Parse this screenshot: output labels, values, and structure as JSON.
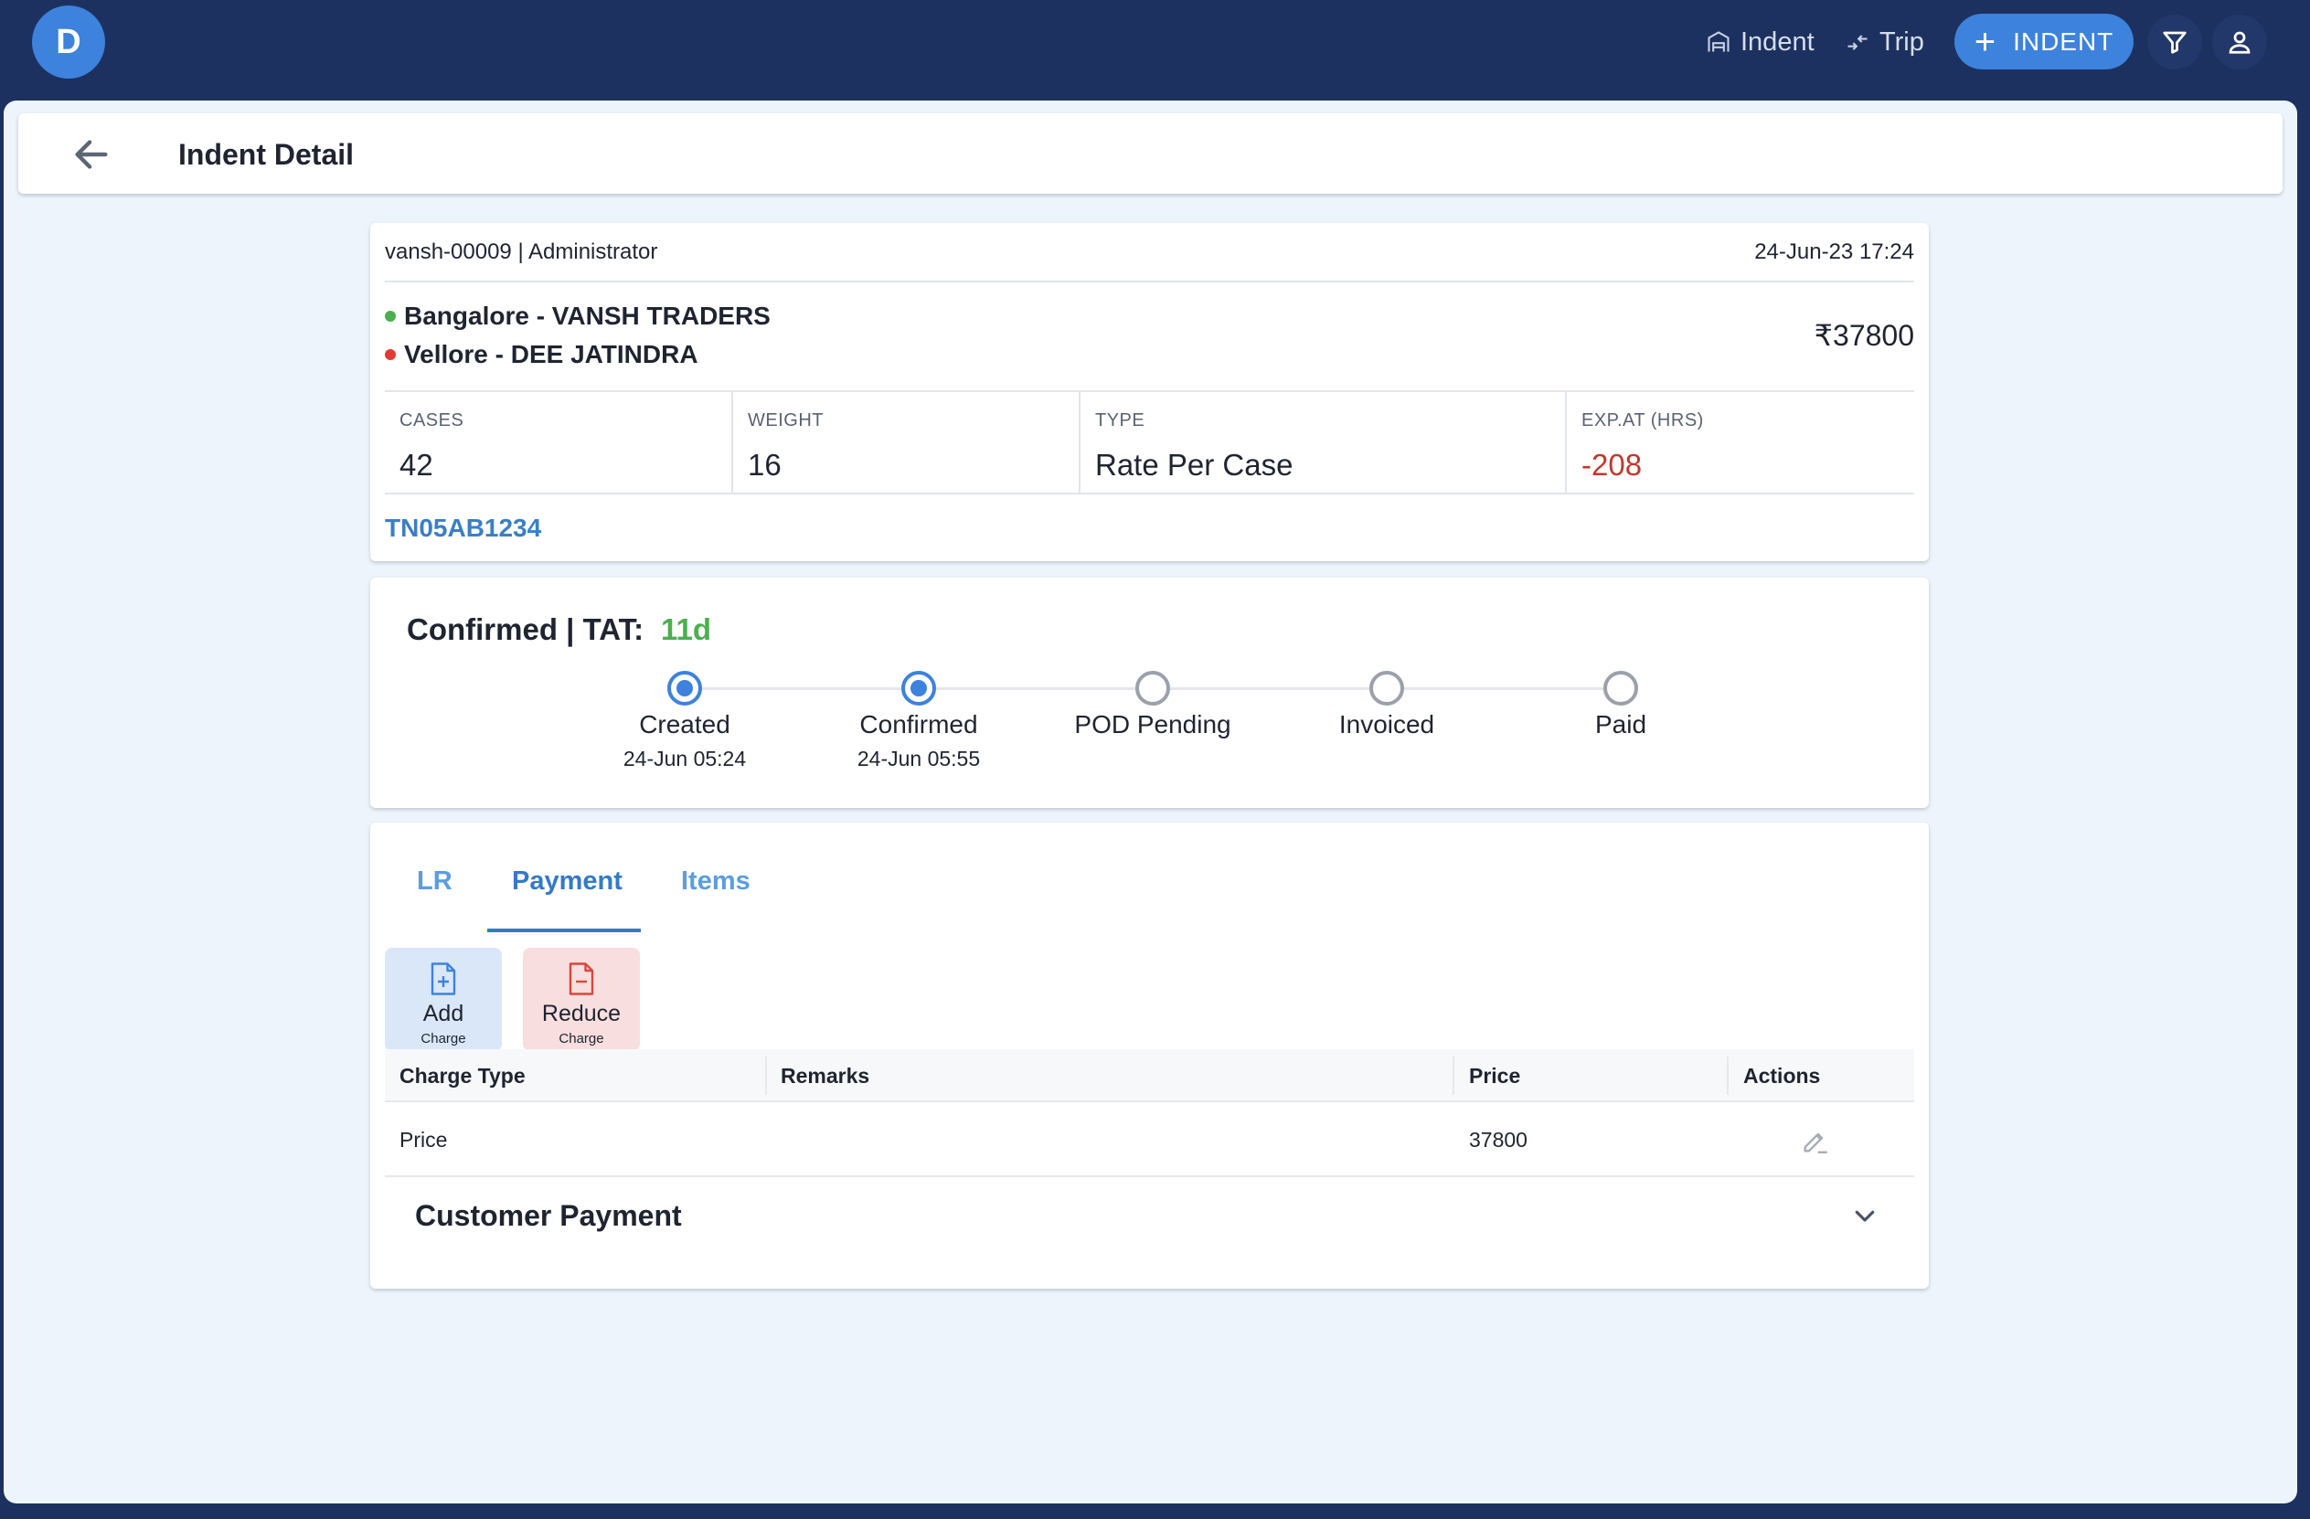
{
  "topbar": {
    "avatar_letter": "D",
    "nav_indent": "Indent",
    "nav_trip": "Trip",
    "new_indent_label": "INDENT",
    "brand_color": "#3d82dd",
    "bg_color": "#1c3160"
  },
  "header": {
    "title": "Indent Detail"
  },
  "indent": {
    "user": "vansh-00009 | Administrator",
    "datetime": "24-Jun-23 17:24",
    "from": "Bangalore - VANSH TRADERS",
    "to": "Vellore - DEE JATINDRA",
    "price": "₹37800",
    "stats": [
      {
        "label": "CASES",
        "value": "42"
      },
      {
        "label": "WEIGHT",
        "value": "16"
      },
      {
        "label": "TYPE",
        "value": "Rate Per Case"
      },
      {
        "label": "EXP.AT (HRS)",
        "value": "-208"
      }
    ],
    "vehicle": "TN05AB1234"
  },
  "status": {
    "title": "Confirmed | TAT:",
    "tat": "11d",
    "steps": [
      {
        "label": "Created",
        "date": "24-Jun 05:24",
        "done": true
      },
      {
        "label": "Confirmed",
        "date": "24-Jun 05:55",
        "done": true
      },
      {
        "label": "POD Pending",
        "date": "",
        "done": false
      },
      {
        "label": "Invoiced",
        "date": "",
        "done": false
      },
      {
        "label": "Paid",
        "date": "",
        "done": false
      }
    ]
  },
  "tabs": [
    "LR",
    "Payment",
    "Items"
  ],
  "active_tab": "Payment",
  "charges": {
    "add_label": "Add",
    "add_sub": "Charge",
    "reduce_label": "Reduce",
    "reduce_sub": "Charge"
  },
  "table": {
    "headers": [
      "Charge Type",
      "Remarks",
      "Price",
      "Actions"
    ],
    "rows": [
      {
        "charge_type": "Price",
        "remarks": "",
        "price": "37800"
      }
    ]
  },
  "customer_payment": {
    "title": "Customer Payment"
  }
}
